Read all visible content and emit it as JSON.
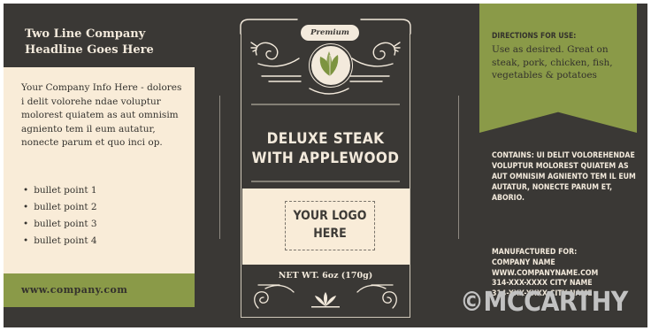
{
  "colors": {
    "background": "#3a3835",
    "cream": "#f9ecd8",
    "olive_green": "#8a9a48",
    "ornament": "#f3eadc"
  },
  "left_panel": {
    "headline": "Two Line Company Headline Goes Here",
    "info": "Your Company Info Here - dolores i delit volorehe ndae voluptur molorest quiatem as aut omnisim agniento tem il eum autatur, nonecte parum et quo inci op.",
    "bullets": [
      "bullet point 1",
      "bullet point 2",
      "bullet point 3",
      "bullet point 4"
    ],
    "website": "www.company.com"
  },
  "center_panel": {
    "badge": "Premium",
    "product_name_line1": "DELUXE STEAK",
    "product_name_line2": "WITH APPLEWOOD",
    "logo_line1": "YOUR LOGO",
    "logo_line2": "HERE",
    "net_weight": "NET WT. 6oz (170g)",
    "icons": [
      "leaf-icon",
      "flourish-ornament",
      "lotus-ornament"
    ]
  },
  "right_panel": {
    "directions_title": "DIRECTIONS FOR USE:",
    "directions_body": "Use as desired. Great on steak, pork, chicken, fish, vegetables & potatoes",
    "contains": "CONTAINS: UI DELIT VOLOREHENDAE VOLUPTUR MOLOREST QUIATEM AS AUT OMNISIM AGNIENTO TEM IL EUM AUTATUR, NONECTE PARUM ET, ABORIO.",
    "manufacturer": {
      "line1": "MANUFACTURED FOR:",
      "line2": "COMPANY NAME",
      "line3": "WWW.COMPANYNAME.COM",
      "line4": "314-XXX-XXXX  CITY NAME",
      "line5": "314-XXX-XXXX  CITY NAME"
    }
  },
  "watermark": "©MCCARTHY"
}
